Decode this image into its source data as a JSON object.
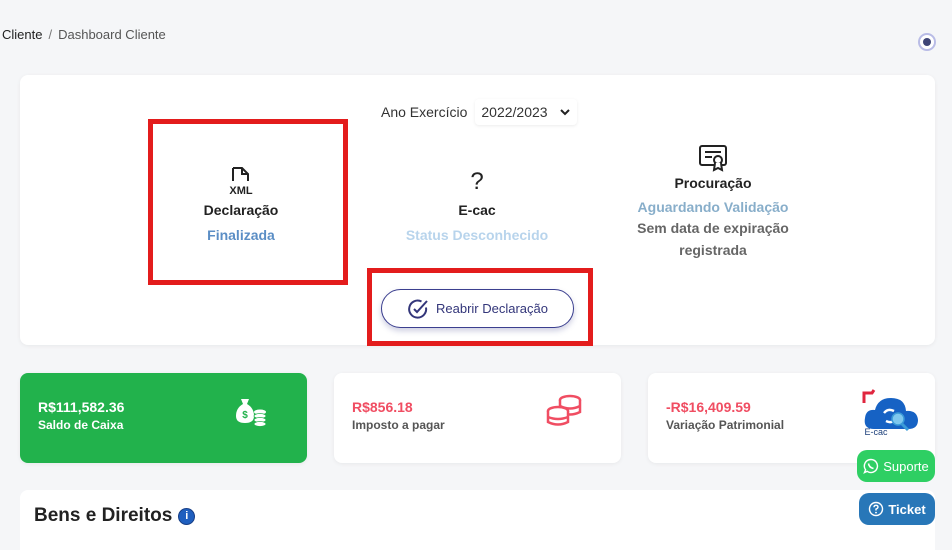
{
  "breadcrumb": {
    "root": "Cliente",
    "separator": "/",
    "current": "Dashboard Cliente"
  },
  "year": {
    "label": "Ano Exercício",
    "selected": "2022/2023"
  },
  "status": {
    "declaracao": {
      "icon": "xml-file-icon",
      "title": "Declaração",
      "status": "Finalizada"
    },
    "ecac": {
      "icon": "question-icon",
      "icon_glyph": "?",
      "title": "E-cac",
      "status": "Status Desconhecido"
    },
    "procuracao": {
      "icon": "certificate-icon",
      "title": "Procuração",
      "status": "Aguardando Validação",
      "expiry": "Sem data de expiração registrada"
    }
  },
  "reopen_button": {
    "label": "Reabrir Declaração"
  },
  "cards": [
    {
      "value": "R$111,582.36",
      "label": "Saldo de Caixa",
      "icon": "money-bag-icon",
      "color": "#22b24c"
    },
    {
      "value": "R$856.18",
      "label": "Imposto a pagar",
      "icon": "coins-stack-icon",
      "color": "#f04d62"
    },
    {
      "value": "-R$16,409.59",
      "label": "Variação Patrimonial",
      "icon": "ecac-cloud-icon",
      "icon_caption": "E-cac",
      "color": "#f04d62"
    }
  ],
  "support": {
    "suporte_label": "Suporte",
    "ticket_label": "Ticket"
  },
  "bens": {
    "title": "Bens e Direitos",
    "info_glyph": "i"
  },
  "colors": {
    "accent": "#3b3f8f",
    "highlight": "#e31c1c",
    "success": "#22b24c",
    "whatsapp": "#2ecf63",
    "ticket": "#2877b8"
  }
}
